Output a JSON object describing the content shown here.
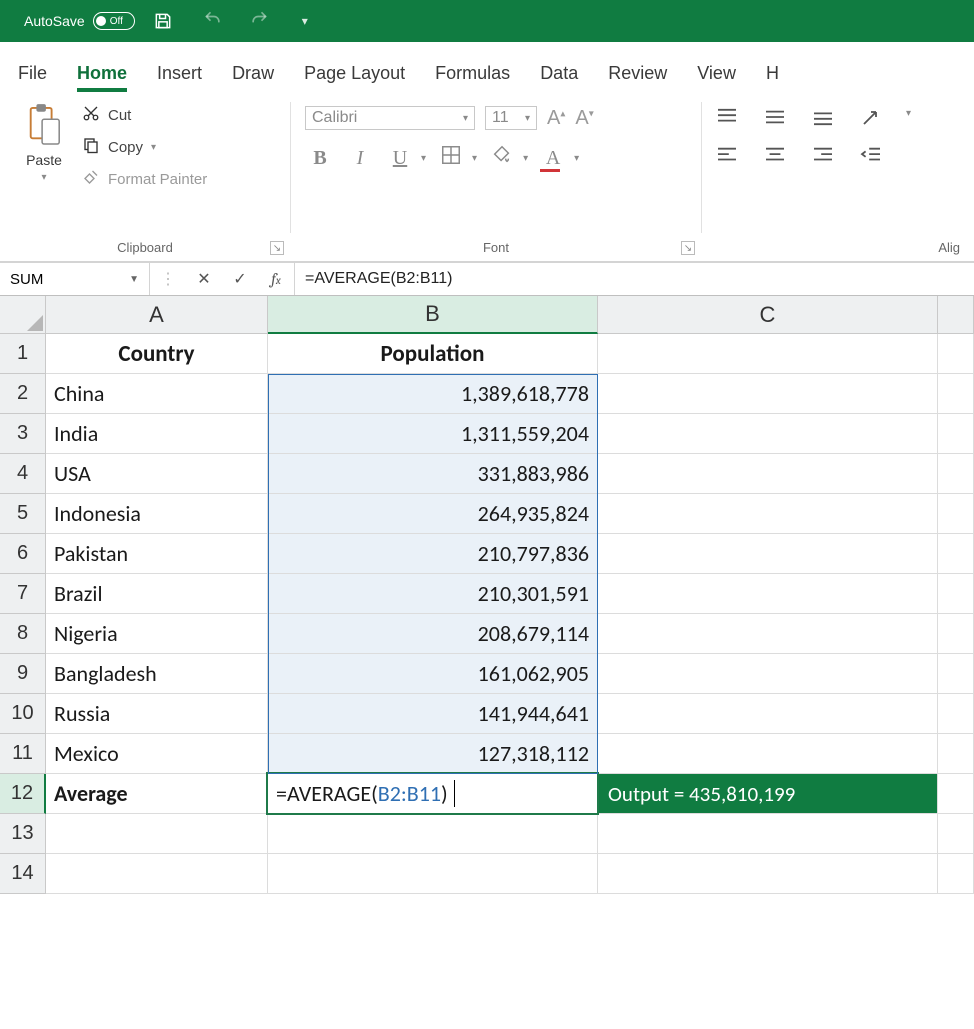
{
  "titlebar": {
    "autosave_label": "AutoSave",
    "autosave_state": "Off"
  },
  "tabs": {
    "file": "File",
    "home": "Home",
    "insert": "Insert",
    "draw": "Draw",
    "page_layout": "Page Layout",
    "formulas": "Formulas",
    "data": "Data",
    "review": "Review",
    "view": "View",
    "help_initial": "H"
  },
  "ribbon": {
    "paste": "Paste",
    "cut": "Cut",
    "copy": "Copy",
    "format_painter": "Format Painter",
    "clipboard_group": "Clipboard",
    "font_name": "Calibri",
    "font_size": "11",
    "font_group": "Font",
    "align_group_partial": "Alig"
  },
  "formula_bar": {
    "name_box": "SUM",
    "formula": "=AVERAGE(B2:B11)"
  },
  "columns": {
    "a": "A",
    "b": "B",
    "c": "C"
  },
  "rows": [
    "1",
    "2",
    "3",
    "4",
    "5",
    "6",
    "7",
    "8",
    "9",
    "10",
    "11",
    "12",
    "13",
    "14"
  ],
  "sheet": {
    "headers": {
      "country": "Country",
      "population": "Population"
    },
    "data": [
      {
        "country": "China",
        "population": "1,389,618,778"
      },
      {
        "country": "India",
        "population": "1,311,559,204"
      },
      {
        "country": "USA",
        "population": "331,883,986"
      },
      {
        "country": "Indonesia",
        "population": "264,935,824"
      },
      {
        "country": "Pakistan",
        "population": "210,797,836"
      },
      {
        "country": "Brazil",
        "population": "210,301,591"
      },
      {
        "country": "Nigeria",
        "population": "208,679,114"
      },
      {
        "country": "Bangladesh",
        "population": "161,062,905"
      },
      {
        "country": "Russia",
        "population": "141,944,641"
      },
      {
        "country": "Mexico",
        "population": "127,318,112"
      }
    ],
    "average_label": "Average",
    "b12_prefix": "=AVERAGE(",
    "b12_ref": "B2:B11",
    "b12_suffix": ")",
    "output_cell": "Output = 435,810,199"
  }
}
